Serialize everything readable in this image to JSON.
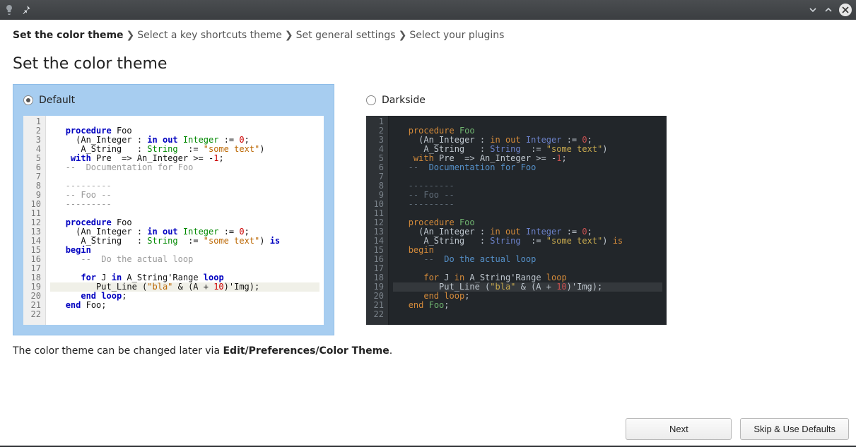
{
  "breadcrumb": {
    "steps": [
      "Set the color theme",
      "Select a key shortcuts theme",
      "Set general settings",
      "Select your plugins"
    ],
    "active_index": 0
  },
  "page_title": "Set the color theme",
  "themes": {
    "default": {
      "label": "Default",
      "selected": true
    },
    "darkside": {
      "label": "Darkside",
      "selected": false
    }
  },
  "code_sample": {
    "line_count": 22,
    "lines": [
      "",
      "   procedure Foo",
      "     (An_Integer : in out Integer := 0;",
      "      A_String   : String  := \"some text\")",
      "    with Pre  => An_Integer >= -1;",
      "   --  Documentation for Foo",
      "",
      "   ---------",
      "   -- Foo --",
      "   ---------",
      "",
      "   procedure Foo",
      "     (An_Integer : in out Integer := 0;",
      "      A_String   : String  := \"some text\") is",
      "   begin",
      "      --  Do the actual loop",
      "",
      "      for J in A_String'Range loop",
      "         Put_Line (\"bla\" & (A + 10)'Img);",
      "      end loop;",
      "   end Foo;",
      ""
    ],
    "highlighted_line": 19
  },
  "footnote": {
    "prefix": "The color theme can be changed later via ",
    "strong": "Edit/Preferences/Color Theme",
    "suffix": "."
  },
  "buttons": {
    "next": "Next",
    "skip": "Skip & Use Defaults"
  }
}
